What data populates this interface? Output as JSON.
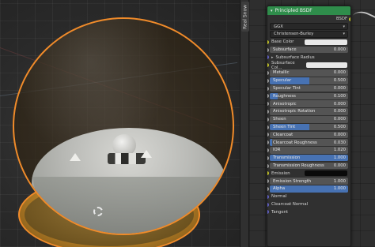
{
  "viewport": {
    "sidebar_tab": "Real Snow"
  },
  "node": {
    "title": "Principled BSDF",
    "output_label": "BSDF",
    "distribution": "GGX",
    "subsurface_method": "Christensen-Burley",
    "inputs": [
      {
        "label": "Base Color",
        "type": "color",
        "value": "",
        "socket": "yellow"
      },
      {
        "label": "Subsurface",
        "type": "number",
        "value": "0.000",
        "fill": 0.0,
        "socket": "grey"
      },
      {
        "label": "Subsurface Radius",
        "type": "vector",
        "value": "",
        "socket": "purple"
      },
      {
        "label": "Subsurface Col...",
        "type": "color",
        "value": "",
        "socket": "yellow"
      },
      {
        "label": "Metallic",
        "type": "number",
        "value": "0.000",
        "fill": 0.0,
        "socket": "grey"
      },
      {
        "label": "Specular",
        "type": "number",
        "value": "0.500",
        "fill": 0.5,
        "socket": "grey"
      },
      {
        "label": "Specular Tint",
        "type": "number",
        "value": "0.000",
        "fill": 0.0,
        "socket": "grey"
      },
      {
        "label": "Roughness",
        "type": "number",
        "value": "0.100",
        "fill": 0.1,
        "socket": "grey"
      },
      {
        "label": "Anisotropic",
        "type": "number",
        "value": "0.000",
        "fill": 0.0,
        "socket": "grey"
      },
      {
        "label": "Anisotropic Rotation",
        "type": "number",
        "value": "0.000",
        "fill": 0.0,
        "socket": "grey"
      },
      {
        "label": "Sheen",
        "type": "number",
        "value": "0.000",
        "fill": 0.0,
        "socket": "grey"
      },
      {
        "label": "Sheen Tint",
        "type": "number",
        "value": "0.500",
        "fill": 0.5,
        "socket": "grey"
      },
      {
        "label": "Clearcoat",
        "type": "number",
        "value": "0.000",
        "fill": 0.0,
        "socket": "grey"
      },
      {
        "label": "Clearcoat Roughness",
        "type": "number",
        "value": "0.030",
        "fill": 0.03,
        "socket": "grey"
      },
      {
        "label": "IOR",
        "type": "number",
        "value": "1.020",
        "fill": 0.0,
        "socket": "grey"
      },
      {
        "label": "Transmission",
        "type": "number",
        "value": "1.000",
        "fill": 1.0,
        "socket": "grey"
      },
      {
        "label": "Transmission Roughness",
        "type": "number",
        "value": "0.000",
        "fill": 0.0,
        "socket": "grey"
      },
      {
        "label": "Emission",
        "type": "color_dark",
        "value": "",
        "socket": "yellow"
      },
      {
        "label": "Emission Strength",
        "type": "number",
        "value": "1.000",
        "fill": 0.0,
        "socket": "grey"
      },
      {
        "label": "Alpha",
        "type": "number",
        "value": "1.000",
        "fill": 1.0,
        "socket": "grey"
      },
      {
        "label": "Normal",
        "type": "plain",
        "value": "",
        "socket": "purple"
      },
      {
        "label": "Clearcoat Normal",
        "type": "plain",
        "value": "",
        "socket": "purple"
      },
      {
        "label": "Tangent",
        "type": "plain",
        "value": "",
        "socket": "purple"
      }
    ]
  },
  "colors": {
    "header_green": "#2f8d4b",
    "selection_orange": "#f08b2a",
    "slider_blue": "#4772b3",
    "socket_yellow": "#c7c729",
    "socket_grey": "#a1a1a1",
    "socket_purple": "#6363c7"
  }
}
